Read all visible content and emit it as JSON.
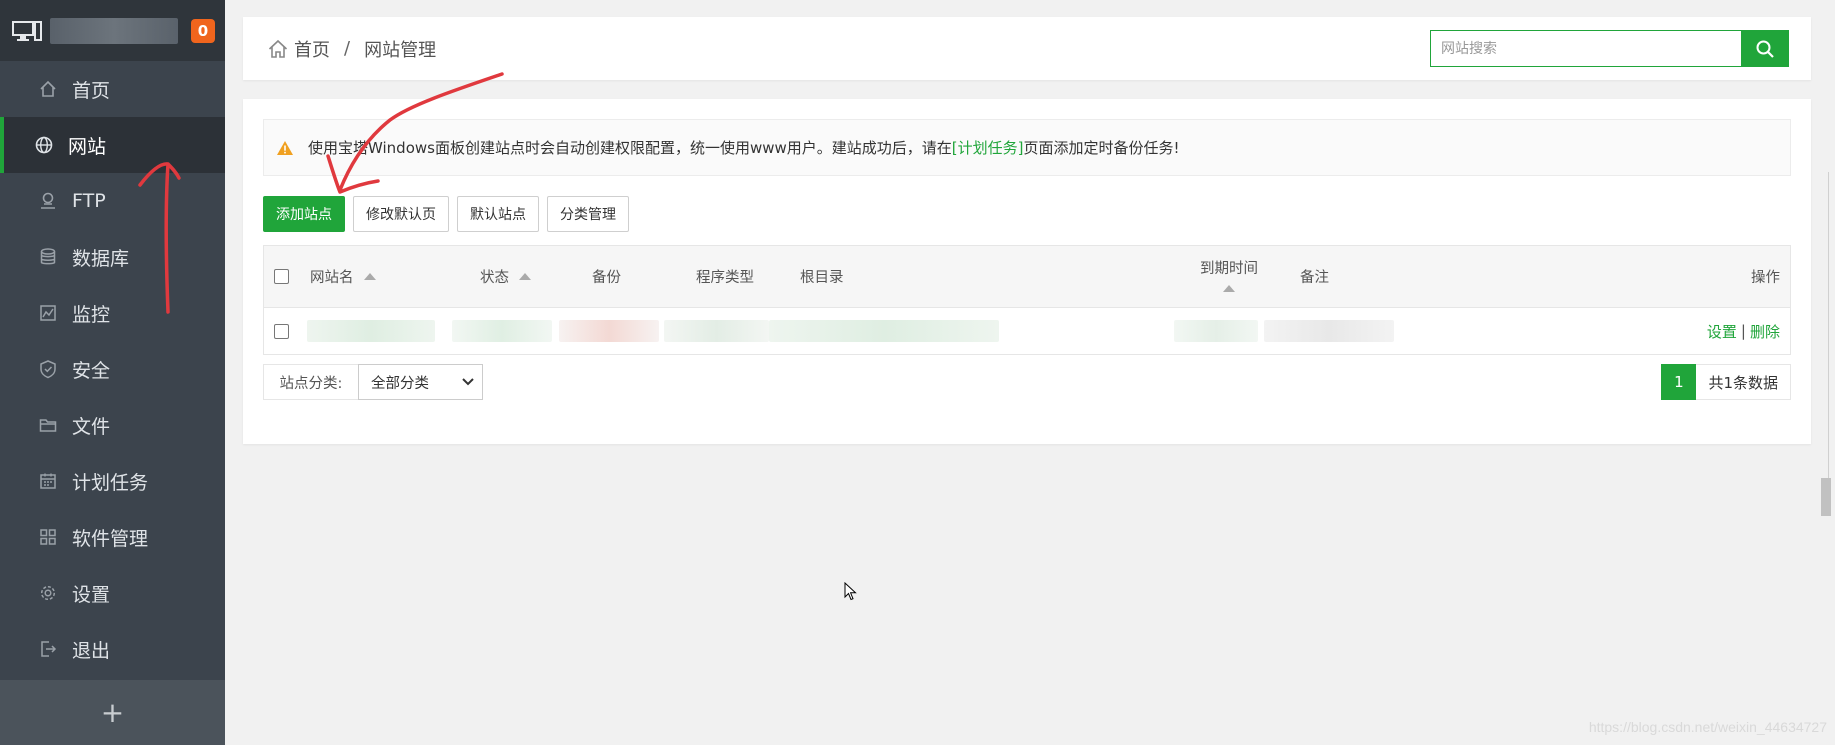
{
  "sidebar": {
    "badge": "0",
    "items": [
      {
        "label": "首页",
        "icon": "home-icon"
      },
      {
        "label": "网站",
        "icon": "globe-icon",
        "active": true
      },
      {
        "label": "FTP",
        "icon": "ftp-icon"
      },
      {
        "label": "数据库",
        "icon": "database-icon"
      },
      {
        "label": "监控",
        "icon": "monitor-chart-icon"
      },
      {
        "label": "安全",
        "icon": "shield-icon"
      },
      {
        "label": "文件",
        "icon": "folder-icon"
      },
      {
        "label": "计划任务",
        "icon": "calendar-icon"
      },
      {
        "label": "软件管理",
        "icon": "grid-icon"
      },
      {
        "label": "设置",
        "icon": "gear-icon"
      },
      {
        "label": "退出",
        "icon": "logout-icon"
      }
    ],
    "add_label": "+"
  },
  "header": {
    "breadcrumb_home": "首页",
    "breadcrumb_sep": "/",
    "breadcrumb_current": "网站管理",
    "search_placeholder": "网站搜索"
  },
  "notice": {
    "text_before": "使用宝塔Windows面板创建站点时会自动创建权限配置，统一使用www用户。建站成功后，请在",
    "link": "[计划任务]",
    "text_after": "页面添加定时备份任务!"
  },
  "toolbar": {
    "add_site": "添加站点",
    "edit_default_page": "修改默认页",
    "default_site": "默认站点",
    "category_manage": "分类管理"
  },
  "table": {
    "headers": {
      "name": "网站名",
      "status": "状态",
      "backup": "备份",
      "program_type": "程序类型",
      "root_dir": "根目录",
      "expire": "到期时间",
      "remark": "备注",
      "actions": "操作"
    },
    "rows": [
      {
        "settings": "设置",
        "sep": "|",
        "delete": "删除"
      }
    ]
  },
  "footer": {
    "category_label": "站点分类:",
    "category_selected": "全部分类",
    "current_page": "1",
    "total": "共1条数据"
  },
  "watermark": "https://blog.csdn.net/weixin_44634727",
  "colors": {
    "accent": "#20a53a",
    "sidebar_bg": "#3c444d",
    "badge": "#f0651d",
    "annotation": "#e0393e"
  }
}
